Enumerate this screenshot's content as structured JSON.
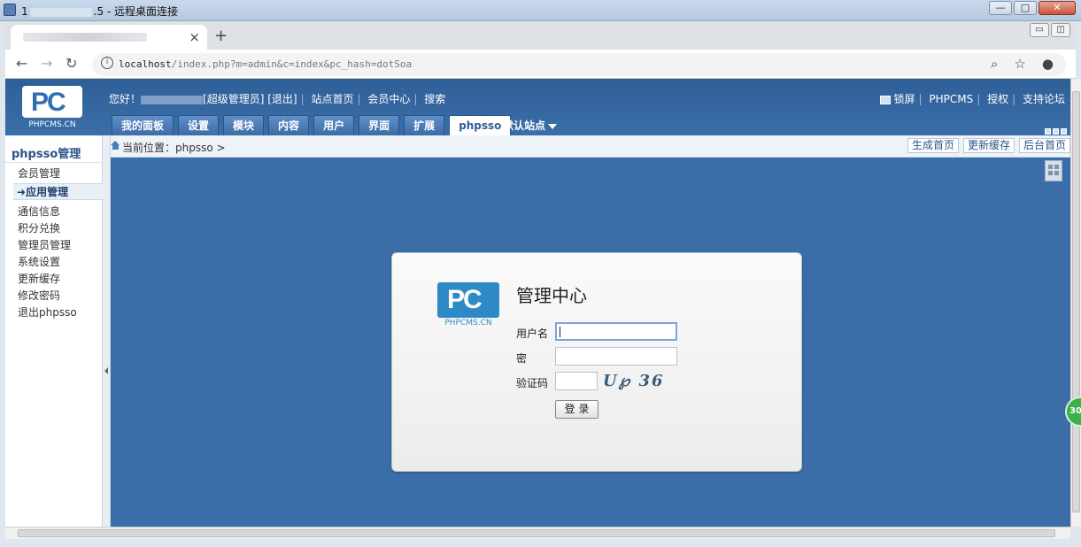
{
  "window": {
    "title_prefix": "1",
    "title_suffix": ".5 - 远程桌面连接",
    "controls": [
      "—",
      "□",
      "✕"
    ]
  },
  "browser": {
    "tab_close": "×",
    "new_tab": "+",
    "url_host": "localhost",
    "url_path": "/index.php?m=admin&c=index&pc_hash=dotSoa"
  },
  "header": {
    "logo_text": "PHPCMS.CN",
    "greeting": "您好！",
    "role": "[超级管理员]",
    "logout": "[退出]",
    "site_home": "站点首页",
    "member_center": "会员中心",
    "search": "搜索",
    "lock_screen": "锁屏",
    "phpcms": "PHPCMS",
    "license": "授权",
    "support": "支持论坛",
    "default_site": "默认站点"
  },
  "nav": [
    {
      "label": "我的面板",
      "active": false
    },
    {
      "label": "设置",
      "active": false
    },
    {
      "label": "模块",
      "active": false
    },
    {
      "label": "内容",
      "active": false
    },
    {
      "label": "用户",
      "active": false
    },
    {
      "label": "界面",
      "active": false
    },
    {
      "label": "扩展",
      "active": false
    },
    {
      "label": "phpsso",
      "active": true
    }
  ],
  "sidebar": {
    "title": "phpsso管理",
    "items": [
      {
        "label": "会员管理",
        "active": false
      },
      {
        "label": "应用管理",
        "active": true
      },
      {
        "label": "通信信息",
        "active": false
      },
      {
        "label": "积分兑换",
        "active": false
      },
      {
        "label": "管理员管理",
        "active": false
      },
      {
        "label": "系统设置",
        "active": false
      },
      {
        "label": "更新缓存",
        "active": false
      },
      {
        "label": "修改密码",
        "active": false
      },
      {
        "label": "退出phpsso",
        "active": false
      }
    ]
  },
  "breadcrumb": {
    "text": "当前位置：phpsso >",
    "buttons": [
      "生成首页",
      "更新缓存",
      "后台首页"
    ]
  },
  "login": {
    "logo_text": "PHPCMS.CN",
    "title": "管理中心",
    "username_label": "用户名",
    "password_label": "密",
    "captcha_label": "验证码",
    "captcha_text": "U℘ 36",
    "submit": "登 录"
  },
  "side_badge": "30"
}
